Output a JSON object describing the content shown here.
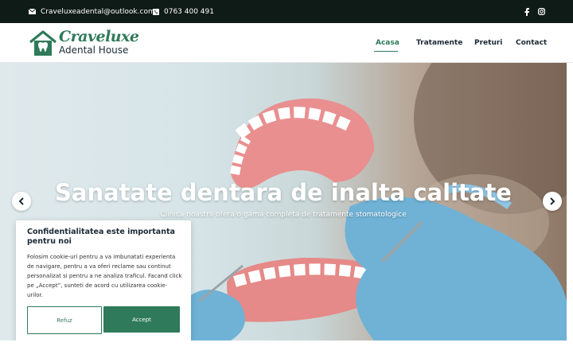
{
  "topbar": {
    "email": "Craveluxeadental@outlook.com",
    "phone": "0763 400 491",
    "social": [
      "facebook-icon",
      "instagram-icon"
    ]
  },
  "logo": {
    "line1": "Craveluxe",
    "line2": "Adental House"
  },
  "nav": {
    "items": [
      {
        "label": "Acasa",
        "active": true
      },
      {
        "label": "Tratamente",
        "active": false
      },
      {
        "label": "Preturi",
        "active": false
      },
      {
        "label": "Contact",
        "active": false
      }
    ]
  },
  "hero": {
    "title": "Sanatate dentara de inalta calitate",
    "subtitle": "Clinica noastra ofera o gama completa de tratamente stomatologice"
  },
  "cookie": {
    "title": "Confidentialitatea este importanta pentru noi",
    "body": "Folosim cookie-uri pentru a va imbunatati experienta de navigare, pentru a va oferi reclame sau continut personalizat si pentru a ne analiza traficul. Facand click pe „Accept”, sunteti de acord cu utilizarea cookie-urilor.",
    "refuse_label": "Refuz",
    "accept_label": "Accept"
  },
  "colors": {
    "brand": "#2f7a5a",
    "topbar": "#0f1b16",
    "text": "#1b2a36"
  }
}
